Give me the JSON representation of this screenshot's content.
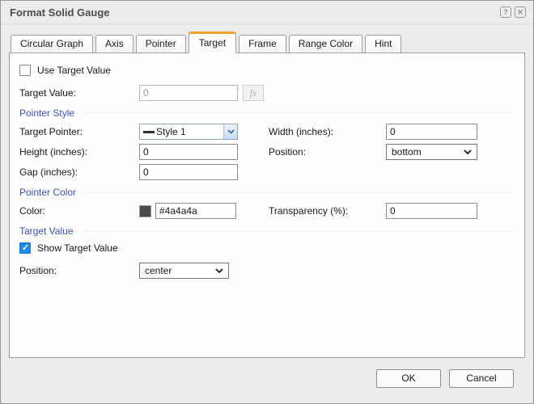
{
  "dialog": {
    "title": "Format Solid Gauge"
  },
  "titlebar_buttons": {
    "help": "?",
    "close": "✕"
  },
  "tabs": [
    {
      "label": "Circular Graph",
      "active": false
    },
    {
      "label": "Axis",
      "active": false
    },
    {
      "label": "Pointer",
      "active": false
    },
    {
      "label": "Target",
      "active": true
    },
    {
      "label": "Frame",
      "active": false
    },
    {
      "label": "Range Color",
      "active": false
    },
    {
      "label": "Hint",
      "active": false
    }
  ],
  "form": {
    "use_target_value": {
      "label": "Use Target Value",
      "checked": false
    },
    "target_value": {
      "label": "Target Value:",
      "value": "0",
      "fx": "fx",
      "disabled": true
    },
    "sections": {
      "pointer_style": "Pointer Style",
      "pointer_color": "Pointer Color",
      "target_value": "Target Value"
    },
    "target_pointer": {
      "label": "Target Pointer:",
      "value": "Style 1"
    },
    "width": {
      "label": "Width (inches):",
      "value": "0"
    },
    "height": {
      "label": "Height (inches):",
      "value": "0"
    },
    "position": {
      "label": "Position:",
      "value": "bottom"
    },
    "gap": {
      "label": "Gap (inches):",
      "value": "0"
    },
    "color": {
      "label": "Color:",
      "value": "#4a4a4a",
      "swatch": "#4a4a4a"
    },
    "transparency": {
      "label": "Transparency (%):",
      "value": "0"
    },
    "show_target_value": {
      "label": "Show Target Value",
      "checked": true
    },
    "target_position": {
      "label": "Position:",
      "value": "center"
    }
  },
  "footer": {
    "ok": "OK",
    "cancel": "Cancel"
  },
  "colors": {
    "active_tab_accent": "#f0a330",
    "section_header": "#3c50c8",
    "checkbox_checked": "#1e88e5",
    "pointer_color_swatch": "#4a4a4a"
  }
}
